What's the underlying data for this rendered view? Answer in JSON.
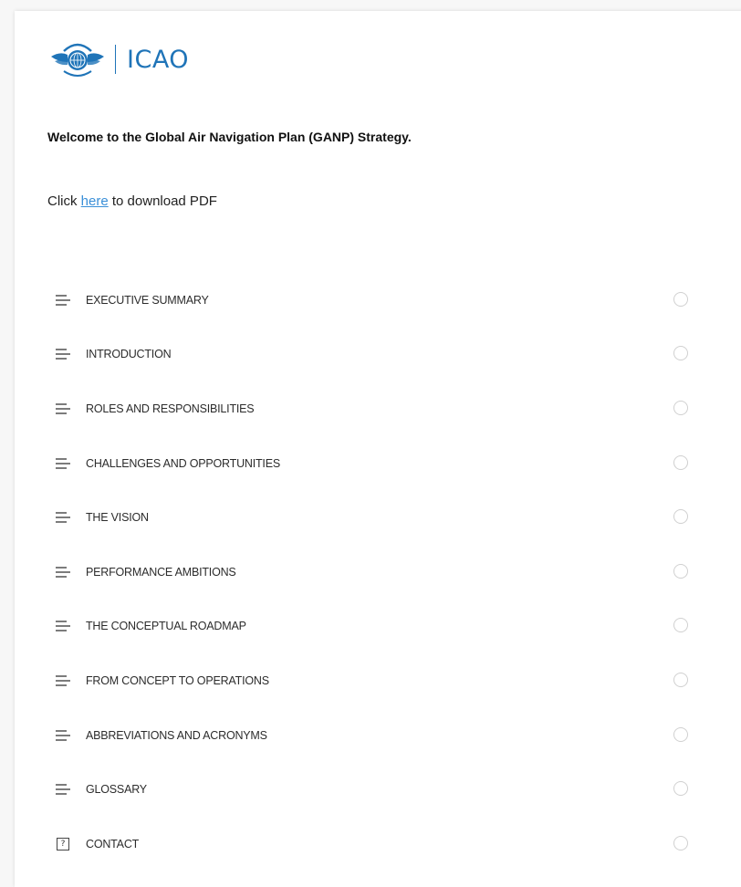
{
  "header": {
    "logo_text": "ICAO"
  },
  "intro": {
    "welcome": "Welcome to the Global Air Navigation Plan (GANP) Strategy.",
    "download_prefix": "Click ",
    "download_link": "here",
    "download_suffix": " to download PDF"
  },
  "toc": {
    "items": [
      {
        "label": "EXECUTIVE SUMMARY",
        "icon": "lines-icon",
        "completed": false
      },
      {
        "label": "INTRODUCTION",
        "icon": "lines-icon",
        "completed": false
      },
      {
        "label": "ROLES AND RESPONSIBILITIES",
        "icon": "lines-icon",
        "completed": false
      },
      {
        "label": "CHALLENGES AND OPPORTUNITIES",
        "icon": "lines-icon",
        "completed": false
      },
      {
        "label": "THE VISION",
        "icon": "lines-icon",
        "completed": false
      },
      {
        "label": "PERFORMANCE AMBITIONS",
        "icon": "lines-icon",
        "completed": false
      },
      {
        "label": "THE CONCEPTUAL ROADMAP",
        "icon": "lines-icon",
        "completed": false
      },
      {
        "label": "FROM CONCEPT TO OPERATIONS",
        "icon": "lines-icon",
        "completed": false
      },
      {
        "label": "ABBREVIATIONS AND ACRONYMS",
        "icon": "lines-icon",
        "completed": false
      },
      {
        "label": "GLOSSARY",
        "icon": "lines-icon",
        "completed": false
      },
      {
        "label": "CONTACT",
        "icon": "question-box-icon",
        "completed": false
      }
    ]
  },
  "colors": {
    "brand_blue": "#1f74b8",
    "link_blue": "#3a8fd8"
  }
}
